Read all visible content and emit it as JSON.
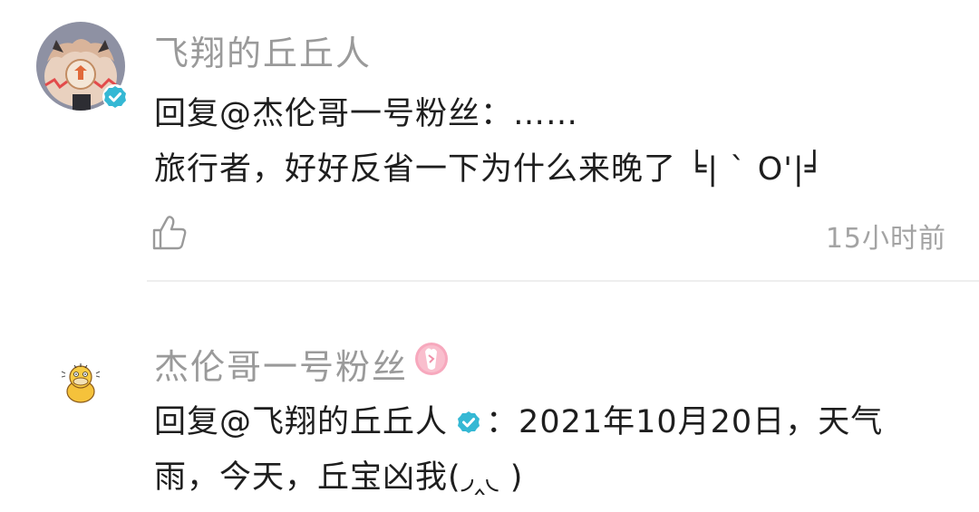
{
  "comments": [
    {
      "avatar_icon": "cartoon-character-avatar",
      "verified_icon": "verified-check-icon",
      "username": "飞翔的丘丘人",
      "reply_prefix": "回复",
      "mention": "@杰伦哥一号粉丝",
      "separator": "：",
      "line1_text": "……",
      "line2_text": "旅行者，好好反省一下为什么来晚了 ╘| ` O'|╛",
      "like_icon": "thumbs-up-icon",
      "timestamp": "15小时前"
    },
    {
      "avatar_icon": "yellow-duck-avatar",
      "username": "杰伦哥一号粉丝",
      "role_icon": "pink-fan-badge-icon",
      "reply_prefix": "回复",
      "mention": "@飞翔的丘丘人",
      "mention_verified_icon": "verified-check-icon",
      "separator": "：",
      "line1_text": "2021年10月20日，天气",
      "line2_text": "雨，今天，丘宝凶我(◞‸◟ )"
    }
  ],
  "colors": {
    "username": "#9a9a9a",
    "body_text": "#1e1e1e",
    "timestamp": "#a3a3a3",
    "verified": "#35b8d4",
    "divider": "#eeeeee",
    "role_badge": "#f08fa8"
  }
}
